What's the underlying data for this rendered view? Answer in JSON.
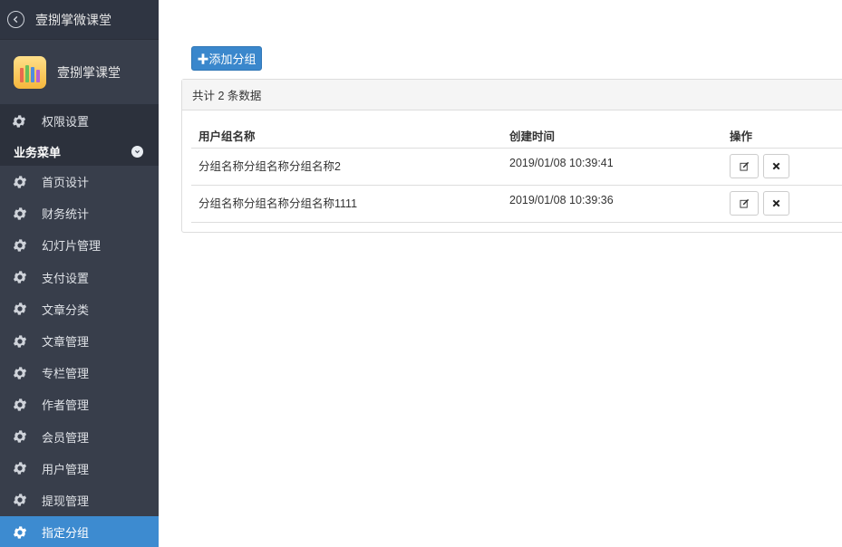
{
  "sidebar": {
    "top_title": "壹捌掌微课堂",
    "brand_name": "壹捌掌课堂",
    "permission_item": "权限设置",
    "group_header": "业务菜单",
    "items": [
      {
        "label": "首页设计"
      },
      {
        "label": "财务统计"
      },
      {
        "label": "幻灯片管理"
      },
      {
        "label": "支付设置"
      },
      {
        "label": "文章分类"
      },
      {
        "label": "文章管理"
      },
      {
        "label": "专栏管理"
      },
      {
        "label": "作者管理"
      },
      {
        "label": "会员管理"
      },
      {
        "label": "用户管理"
      },
      {
        "label": "提现管理"
      },
      {
        "label": "指定分组"
      }
    ],
    "active_index": 11,
    "colors": {
      "background": "#383e4b",
      "active": "#3d8bd0"
    }
  },
  "main": {
    "add_button": "✚添加分组",
    "panel_heading": "共计 2 条数据",
    "table": {
      "headers": [
        "用户组名称",
        "创建时间",
        "操作"
      ],
      "rows": [
        {
          "name": "分组名称分组名称分组名称2",
          "created": "2019/01/08 10:39:41"
        },
        {
          "name": "分组名称分组名称分组名称1111",
          "created": "2019/01/08 10:39:36"
        }
      ],
      "row_actions": [
        "edit-icon",
        "close-icon"
      ]
    }
  }
}
